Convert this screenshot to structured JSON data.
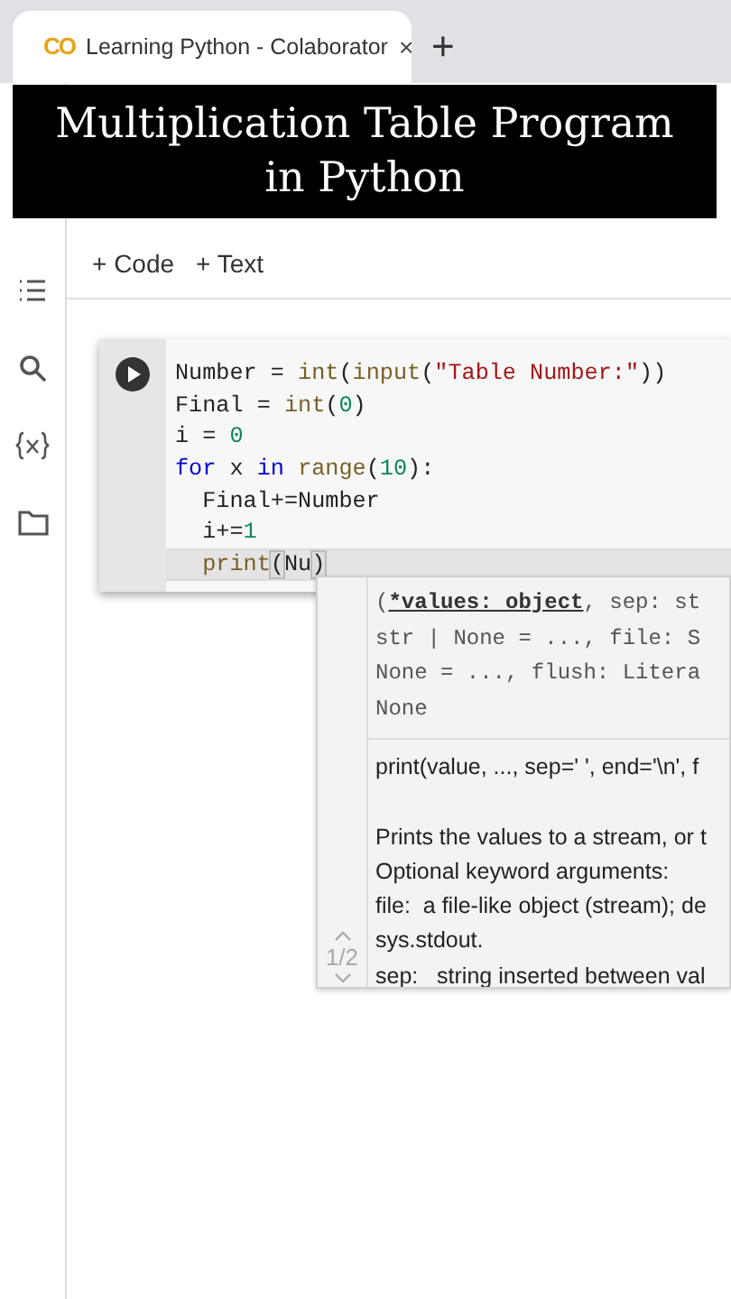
{
  "browser_tab": {
    "logo": "CO",
    "title": "Learning Python - Colaborator",
    "close": "×",
    "new_tab": "+"
  },
  "banner": {
    "lines": [
      "Multiplication Table Program",
      "in Python"
    ]
  },
  "toolbar": {
    "buttons": [
      {
        "icon": "+",
        "label": "Code"
      },
      {
        "icon": "+",
        "label": "Text"
      }
    ]
  },
  "sidebar": {
    "items": [
      {
        "kind": "toc"
      },
      {
        "kind": "search"
      },
      {
        "kind": "variables"
      },
      {
        "kind": "files"
      }
    ]
  },
  "code_cell": {
    "lines": [
      {
        "current": false,
        "tokens": [
          {
            "t": "Number = ",
            "kind": "plain"
          },
          {
            "t": "int",
            "kind": "builtin"
          },
          {
            "t": "(",
            "kind": "plain"
          },
          {
            "t": "input",
            "kind": "builtin"
          },
          {
            "t": "(",
            "kind": "plain"
          },
          {
            "t": "\"Table Number:\"",
            "kind": "string"
          },
          {
            "t": "))",
            "kind": "plain"
          }
        ]
      },
      {
        "current": false,
        "tokens": [
          {
            "t": "Final = ",
            "kind": "plain"
          },
          {
            "t": "int",
            "kind": "builtin"
          },
          {
            "t": "(",
            "kind": "plain"
          },
          {
            "t": "0",
            "kind": "number"
          },
          {
            "t": ")",
            "kind": "plain"
          }
        ]
      },
      {
        "current": false,
        "tokens": [
          {
            "t": "i = ",
            "kind": "plain"
          },
          {
            "t": "0",
            "kind": "number"
          }
        ]
      },
      {
        "current": false,
        "tokens": [
          {
            "t": "for",
            "kind": "keyword"
          },
          {
            "t": " x ",
            "kind": "plain"
          },
          {
            "t": "in ",
            "kind": "keyword"
          },
          {
            "t": "range",
            "kind": "builtin"
          },
          {
            "t": "(",
            "kind": "plain"
          },
          {
            "t": "10",
            "kind": "number"
          },
          {
            "t": "):",
            "kind": "plain"
          }
        ]
      },
      {
        "current": false,
        "tokens": [
          {
            "t": "  Final+=Number",
            "kind": "plain"
          }
        ]
      },
      {
        "current": false,
        "tokens": [
          {
            "t": "  i+=",
            "kind": "plain"
          },
          {
            "t": "1",
            "kind": "number"
          }
        ]
      },
      {
        "current": true,
        "tokens": [
          {
            "t": "  print",
            "kind": "builtin"
          },
          {
            "t": "(",
            "kind": "bracket"
          },
          {
            "t": "Nu",
            "kind": "plain"
          },
          {
            "kind": "cursor"
          },
          {
            "t": ")",
            "kind": "bracket"
          }
        ]
      }
    ]
  },
  "signature_popup": {
    "signature": [
      [
        {
          "t": "(",
          "kind": "plain"
        },
        {
          "t": "*values: object",
          "kind": "active"
        },
        {
          "t": ", sep: st",
          "kind": "plain"
        }
      ],
      [
        {
          "t": "str | None = ..., file: S",
          "kind": "plain"
        }
      ],
      [
        {
          "t": "None = ..., flush: Litera",
          "kind": "plain"
        }
      ],
      [
        {
          "t": "None",
          "kind": "plain"
        }
      ]
    ],
    "doc": [
      "print(value, ..., sep=' ', end='\\n', f",
      "Prints the values to a stream, or t",
      "Optional keyword arguments:",
      "file:  a file-like object (stream); de",
      "sys.stdout.",
      "sep:   string inserted between val"
    ],
    "pager": "1/2"
  }
}
